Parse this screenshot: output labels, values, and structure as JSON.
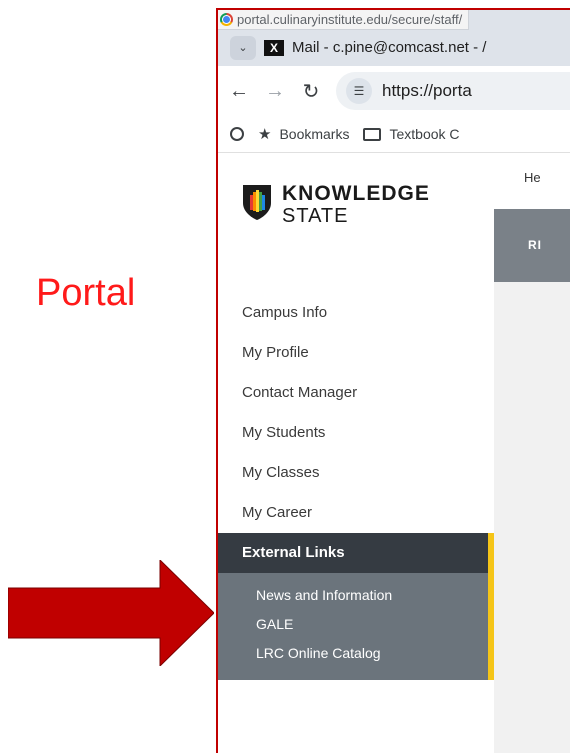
{
  "slide": {
    "title": "Portal",
    "title_color": "#ff1a1a",
    "arrow_color": "#c00000"
  },
  "browser": {
    "hover_url": "portal.culinaryinstitute.edu/secure/staff/",
    "tab_title": "Mail - c.pine@comcast.net - /",
    "address": "https://porta",
    "bookmarks": [
      "Bookmarks",
      "Textbook C"
    ]
  },
  "brand": {
    "line1": "KNOWLEDGE",
    "line2": "STATE"
  },
  "sidebar": {
    "items": [
      {
        "label": "Campus Info"
      },
      {
        "label": "My Profile"
      },
      {
        "label": "Contact Manager"
      },
      {
        "label": "My Students"
      },
      {
        "label": "My Classes"
      },
      {
        "label": "My Career"
      },
      {
        "label": "External Links"
      }
    ],
    "sub_items": [
      {
        "label": "News and Information"
      },
      {
        "label": "GALE"
      },
      {
        "label": "LRC Online Catalog"
      }
    ],
    "accent_color": "#f5c518"
  },
  "main": {
    "tab_fragment": "He",
    "banner_fragment": "RI"
  }
}
